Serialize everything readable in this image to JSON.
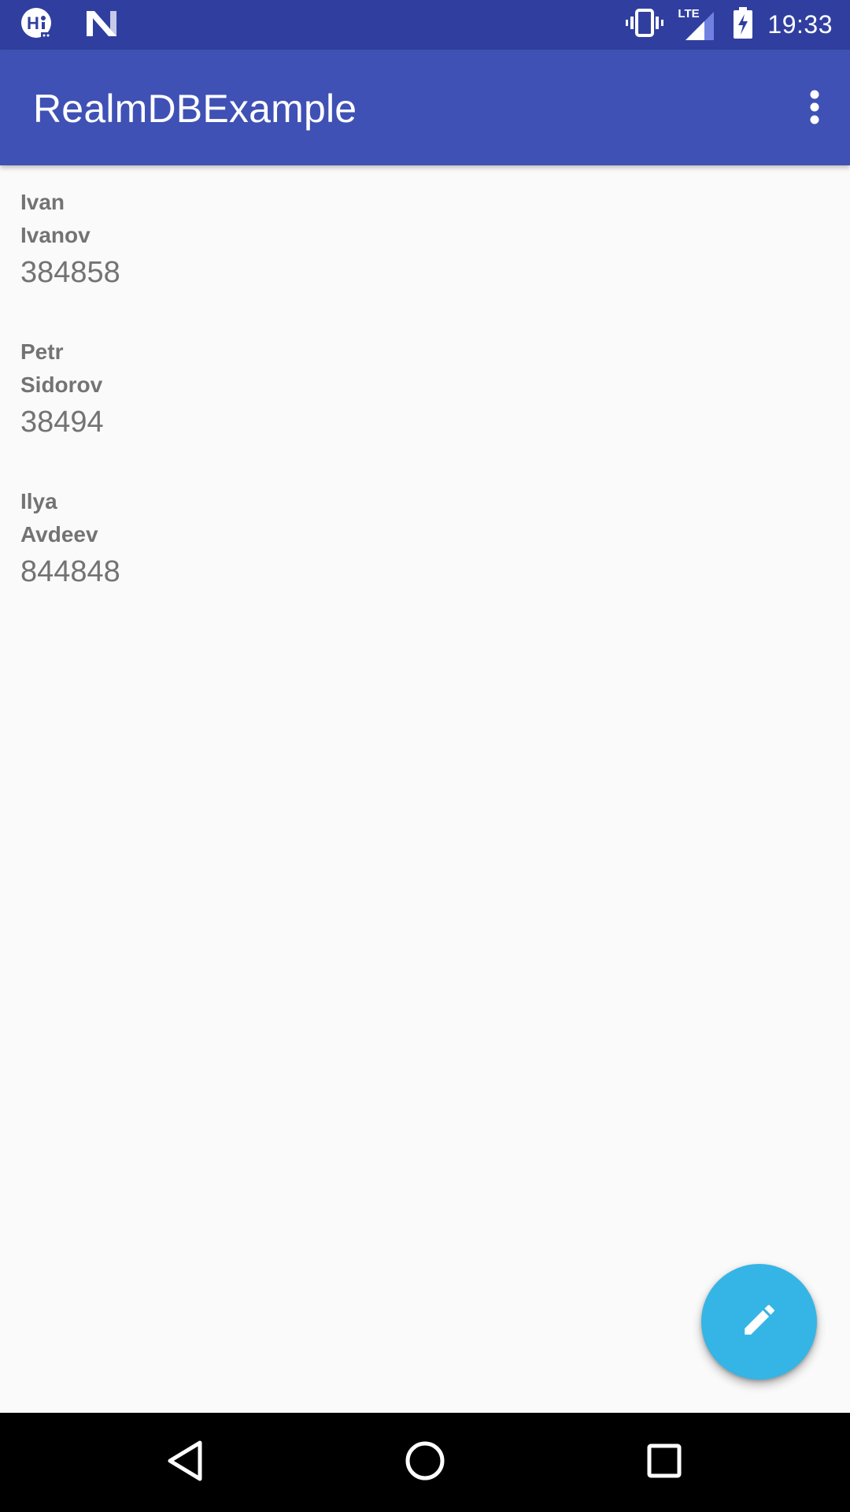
{
  "status_bar": {
    "time": "19:33",
    "network_label": "LTE",
    "left_icons": [
      "hi-app-icon",
      "n-app-icon"
    ],
    "right_icons": [
      "vibrate-icon",
      "lte-signal-icon",
      "battery-charging-icon"
    ]
  },
  "app_bar": {
    "title": "RealmDBExample",
    "overflow_icon": "more-vert-icon"
  },
  "contacts": [
    {
      "first_name": "Ivan",
      "last_name": "Ivanov",
      "phone": "384858"
    },
    {
      "first_name": "Petr",
      "last_name": "Sidorov",
      "phone": "38494"
    },
    {
      "first_name": "Ilya",
      "last_name": "Avdeev",
      "phone": "844848"
    }
  ],
  "fab": {
    "icon": "edit-pencil-icon",
    "color": "#35b5e5"
  },
  "nav_bar": {
    "icons": [
      "back-icon",
      "home-icon",
      "recents-icon"
    ]
  },
  "colors": {
    "status_bar": "#303f9f",
    "app_bar": "#3f51b5",
    "background": "#fafafa",
    "text": "#737373"
  }
}
